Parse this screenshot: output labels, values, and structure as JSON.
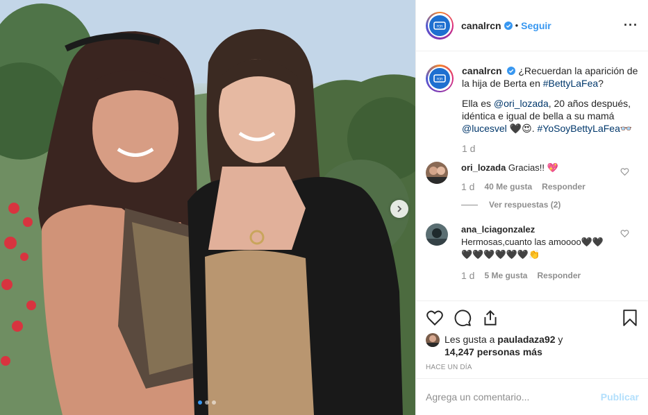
{
  "post": {
    "username": "canalrcn",
    "follow_label": "Seguir",
    "separator": "•",
    "more_label": "···"
  },
  "caption": {
    "username": "canalrcn",
    "line1_text": "¿Recuerdan la aparición de la hija de Berta en ",
    "line1_tag": "#BettyLaFea",
    "line1_end": "?",
    "line2_a": "Ella es ",
    "line2_mention": "@ori_lozada",
    "line2_b": ", 20 años después, idéntica e igual de bella a su mamá ",
    "line2_mention2": "@lucesvel",
    "line2_emoji": " 🖤😍. ",
    "line2_tag": "#YoSoyBettyLaFea",
    "line2_emoji2": "👓",
    "time": "1 d"
  },
  "comments": [
    {
      "username": "ori_lozada",
      "text": "Gracias!! 💖",
      "time": "1 d",
      "likes": "40 Me gusta",
      "reply_label": "Responder",
      "view_replies": "Ver respuestas (2)"
    },
    {
      "username": "ana_lciagonzalez",
      "text": "Hermosas,cuanto las amoooo🖤🖤 🖤🖤🖤🖤🖤🖤👏",
      "time": "1 d",
      "likes": "5 Me gusta",
      "reply_label": "Responder"
    }
  ],
  "likes": {
    "prefix": "Les gusta a ",
    "user": "pauladaza92",
    "middle": " y",
    "count": "14,247 personas más"
  },
  "posted_time": "Hace un día",
  "add_comment": {
    "placeholder": "Agrega un comentario...",
    "publish_label": "Publicar"
  },
  "carousel": {
    "current": 1,
    "total": 3
  },
  "colors": {
    "accent": "#3897f0",
    "verified": "#3897f0",
    "muted": "#8e8e8e",
    "publish_disabled": "#b2dffc"
  },
  "icons": [
    "heart-icon",
    "comment-icon",
    "share-icon",
    "bookmark-icon",
    "verified-icon",
    "chevron-right-icon",
    "more-icon"
  ]
}
